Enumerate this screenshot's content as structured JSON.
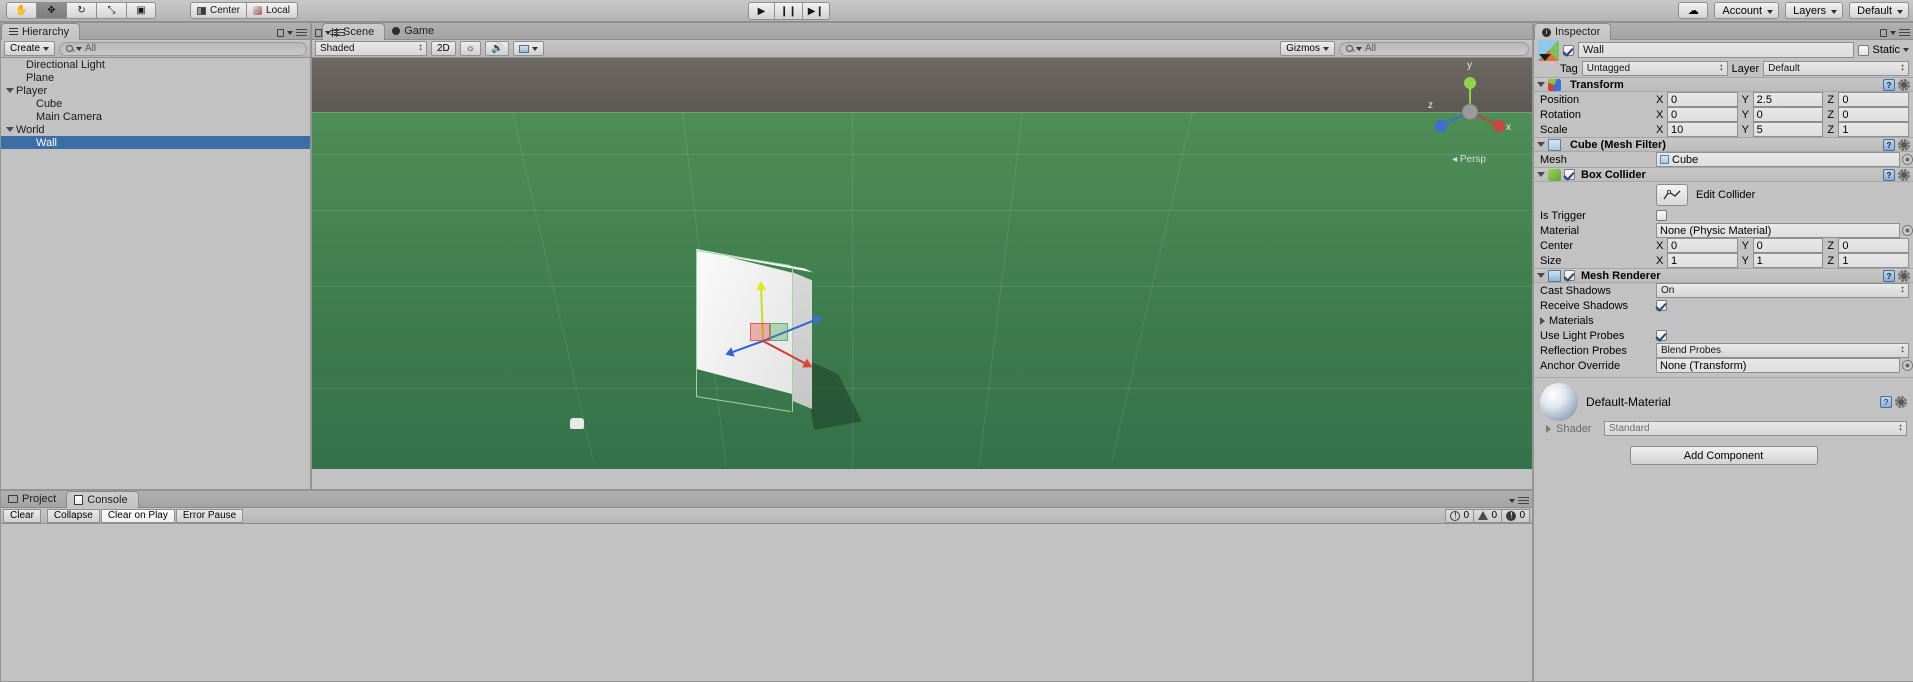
{
  "toolbar": {
    "tools": [
      {
        "name": "hand-tool",
        "glyph": "✋",
        "active": false
      },
      {
        "name": "move-tool",
        "glyph": "✥",
        "active": true
      },
      {
        "name": "rotate-tool",
        "glyph": "↻",
        "active": false
      },
      {
        "name": "scale-tool",
        "glyph": "⤡",
        "active": false
      },
      {
        "name": "rect-tool",
        "glyph": "▣",
        "active": false
      }
    ],
    "pivot_label": "Center",
    "space_label": "Local",
    "play_label": "▶",
    "pause_label": "❙❙",
    "step_label": "▶❙",
    "cloud_label": "☁",
    "account_label": "Account",
    "layers_label": "Layers",
    "layout_label": "Default"
  },
  "hierarchy": {
    "tab_label": "Hierarchy",
    "create_label": "Create",
    "search_placeholder": "All",
    "search_prefix": "Q",
    "items": [
      {
        "label": "Directional Light",
        "depth": 1,
        "expandable": false,
        "selected": false
      },
      {
        "label": "Plane",
        "depth": 1,
        "expandable": false,
        "selected": false
      },
      {
        "label": "Player",
        "depth": 0,
        "expandable": true,
        "selected": false
      },
      {
        "label": "Cube",
        "depth": 2,
        "expandable": false,
        "selected": false
      },
      {
        "label": "Main Camera",
        "depth": 2,
        "expandable": false,
        "selected": false
      },
      {
        "label": "World",
        "depth": 0,
        "expandable": true,
        "selected": false
      },
      {
        "label": "Wall",
        "depth": 2,
        "expandable": false,
        "selected": true
      }
    ]
  },
  "scene": {
    "tab_scene": "Scene",
    "tab_game": "Game",
    "shading_mode": "Shaded",
    "mode_2d": "2D",
    "gizmos_label": "Gizmos",
    "search_placeholder": "All",
    "search_prefix": "Q",
    "camera_label": "Persp",
    "axis_x": "x",
    "axis_y": "y",
    "axis_z": "z"
  },
  "inspector": {
    "tab_label": "Inspector",
    "object_name": "Wall",
    "object_enabled": true,
    "static_label": "Static",
    "static_checked": false,
    "tag_label": "Tag",
    "tag_value": "Untagged",
    "layer_label": "Layer",
    "layer_value": "Default",
    "components": [
      {
        "name": "transform",
        "title": "Transform",
        "has_checkbox": false,
        "rows": [
          {
            "label": "Position",
            "x": "0",
            "y": "2.5",
            "z": "0"
          },
          {
            "label": "Rotation",
            "x": "0",
            "y": "0",
            "z": "0"
          },
          {
            "label": "Scale",
            "x": "10",
            "y": "5",
            "z": "1"
          }
        ]
      },
      {
        "name": "mesh-filter",
        "title": "Cube (Mesh Filter)",
        "has_checkbox": false,
        "mesh_label": "Mesh",
        "mesh_value": "Cube"
      },
      {
        "name": "box-collider",
        "title": "Box Collider",
        "has_checkbox": true,
        "checked": true,
        "edit_collider_label": "Edit Collider",
        "is_trigger_label": "Is Trigger",
        "is_trigger_checked": false,
        "material_label": "Material",
        "material_value": "None (Physic Material)",
        "rows": [
          {
            "label": "Center",
            "x": "0",
            "y": "0",
            "z": "0"
          },
          {
            "label": "Size",
            "x": "1",
            "y": "1",
            "z": "1"
          }
        ]
      },
      {
        "name": "mesh-renderer",
        "title": "Mesh Renderer",
        "has_checkbox": true,
        "checked": true,
        "cast_shadows_label": "Cast Shadows",
        "cast_shadows_value": "On",
        "receive_shadows_label": "Receive Shadows",
        "receive_shadows_checked": true,
        "materials_label": "Materials",
        "use_light_probes_label": "Use Light Probes",
        "use_light_probes_checked": true,
        "reflection_probes_label": "Reflection Probes",
        "reflection_probes_value": "Blend Probes",
        "anchor_override_label": "Anchor Override",
        "anchor_override_value": "None (Transform)"
      }
    ],
    "material_name": "Default-Material",
    "shader_label": "Shader",
    "shader_value": "Standard",
    "add_component_label": "Add Component"
  },
  "bottom": {
    "tab_project": "Project",
    "tab_console": "Console",
    "clear_label": "Clear",
    "collapse_label": "Collapse",
    "clear_on_play_label": "Clear on Play",
    "error_pause_label": "Error Pause",
    "info_count": "0",
    "warning_count": "0",
    "error_count": "0"
  },
  "colors": {
    "selection": "#3a6ea5",
    "ground": "#3f7f4d",
    "chrome": "#c2c2c2"
  }
}
